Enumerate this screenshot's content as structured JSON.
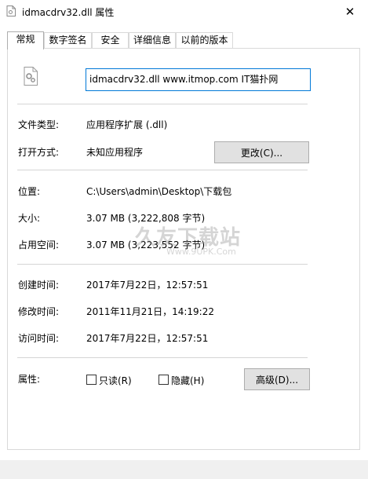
{
  "window": {
    "title": "idmacdrv32.dll 属性",
    "close_glyph": "✕"
  },
  "tabs": [
    {
      "label": "常规",
      "active": true
    },
    {
      "label": "数字签名",
      "active": false
    },
    {
      "label": "安全",
      "active": false
    },
    {
      "label": "详细信息",
      "active": false
    },
    {
      "label": "以前的版本",
      "active": false
    }
  ],
  "file": {
    "icon": "dll-file-gear-icon",
    "name_value": "idmacdrv32.dll www.itmop.com IT猫扑网"
  },
  "type_section": {
    "file_type_label": "文件类型:",
    "file_type_value": "应用程序扩展 (.dll)",
    "open_with_label": "打开方式:",
    "open_with_value": "未知应用程序",
    "change_button": "更改(C)..."
  },
  "location_section": {
    "location_label": "位置:",
    "location_value": "C:\\Users\\admin\\Desktop\\下载包",
    "size_label": "大小:",
    "size_value": "3.07 MB (3,222,808 字节)",
    "disk_size_label": "占用空间:",
    "disk_size_value": "3.07 MB (3,223,552 字节)"
  },
  "time_section": {
    "created_label": "创建时间:",
    "created_value": "2017年7月22日，12:57:51",
    "modified_label": "修改时间:",
    "modified_value": "2011年11月21日，14:19:22",
    "accessed_label": "访问时间:",
    "accessed_value": "2017年7月22日，12:57:51"
  },
  "attributes": {
    "label": "属性:",
    "readonly_label": "只读(R)",
    "readonly_checked": false,
    "hidden_label": "隐藏(H)",
    "hidden_checked": false,
    "advanced_button": "高级(D)..."
  },
  "watermark": {
    "big_text": "久友下载站",
    "small_text": "Www.9UPK.Com"
  },
  "colors": {
    "focus_border": "#0078d7",
    "button_bg": "#e1e1e1",
    "button_border": "#adadad",
    "separator": "#d5d5d5"
  }
}
